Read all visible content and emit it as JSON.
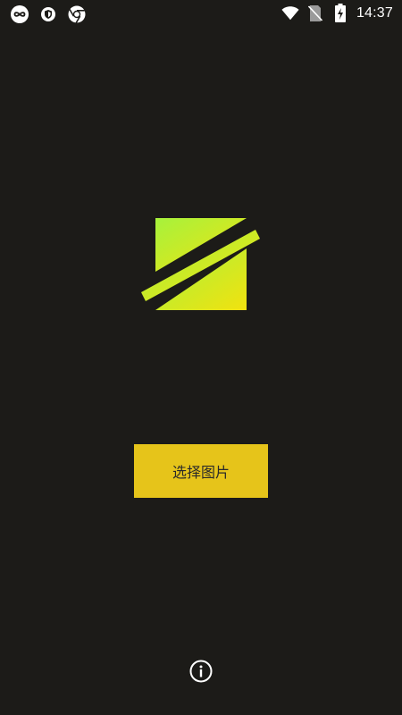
{
  "status_bar": {
    "time": "14:37",
    "left_icons": [
      "infinity-icon",
      "shield-icon",
      "chrome-icon"
    ],
    "right_icons": [
      "wifi-icon",
      "no-sim-icon",
      "battery-charging-icon"
    ]
  },
  "main": {
    "logo_icon": "app-logo-icon",
    "select_button_label": "选择图片",
    "info_icon": "info-icon"
  },
  "colors": {
    "background": "#1c1b18",
    "button": "#e6c41a",
    "logo_gradient_start": "#a6f23c",
    "logo_gradient_end": "#f2e20f"
  }
}
